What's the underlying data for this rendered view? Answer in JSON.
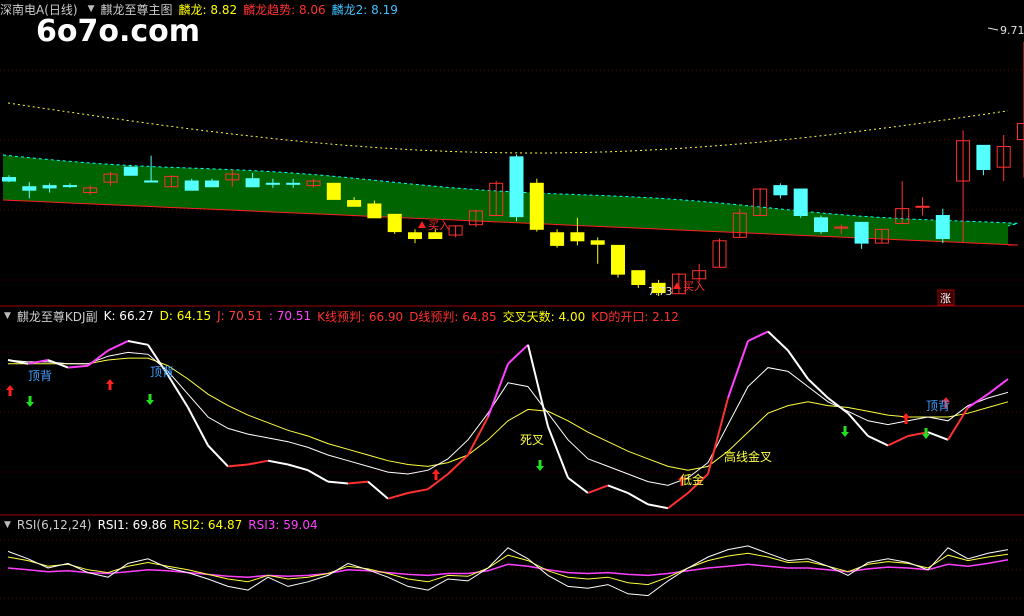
{
  "watermark": "6o7o.com",
  "main": {
    "title": "深南电A(日线)",
    "indicator": "麒龙至尊主图",
    "items": [
      {
        "label": "麟龙: 8.82",
        "color": "#ffff00"
      },
      {
        "label": "麟龙趋势: 8.06",
        "color": "#ff3030"
      },
      {
        "label": "麟龙2: 8.19",
        "color": "#40c0ff"
      }
    ],
    "high_label": "9.71",
    "low_label": "7.73",
    "buy_label": "买入",
    "zhang_badge": "涨"
  },
  "kdj": {
    "title": "麒龙至尊KDJ副",
    "items": [
      {
        "label": "K: 66.27",
        "color": "#ffffff"
      },
      {
        "label": "D: 64.15",
        "color": "#ffff00"
      },
      {
        "label": "J: 70.51",
        "color": "#ff4040"
      },
      {
        "label": ": 70.51",
        "color": "#ff40ff"
      },
      {
        "label": "K线预判: 66.90",
        "color": "#ff3030"
      },
      {
        "label": "D线预判: 64.85",
        "color": "#ff3030"
      },
      {
        "label": "交叉天数: 4.00",
        "color": "#ffff00"
      },
      {
        "label": "KD的开口: 2.12",
        "color": "#ff3030"
      }
    ],
    "annotations": [
      "顶背",
      "顶背",
      "死叉",
      "低金",
      "高线金叉",
      "顶背"
    ]
  },
  "rsi": {
    "title": "RSI(6,12,24)",
    "items": [
      {
        "label": "RSI1: 69.86",
        "color": "#ffffff"
      },
      {
        "label": "RSI2: 64.87",
        "color": "#ffff00"
      },
      {
        "label": "RSI3: 59.04",
        "color": "#ff40ff"
      }
    ]
  },
  "chart_data": {
    "type": "candlestick",
    "y_range": [
      7.5,
      9.9
    ],
    "candles": [
      {
        "o": 8.53,
        "h": 8.55,
        "l": 8.49,
        "c": 8.5,
        "up": false
      },
      {
        "o": 8.42,
        "h": 8.49,
        "l": 8.35,
        "c": 8.45,
        "up": false
      },
      {
        "o": 8.44,
        "h": 8.48,
        "l": 8.4,
        "c": 8.46,
        "up": false
      },
      {
        "o": 8.46,
        "h": 8.48,
        "l": 8.44,
        "c": 8.46,
        "up": false
      },
      {
        "o": 8.4,
        "h": 8.46,
        "l": 8.38,
        "c": 8.44,
        "up": true
      },
      {
        "o": 8.49,
        "h": 8.58,
        "l": 8.46,
        "c": 8.56,
        "up": true
      },
      {
        "o": 8.62,
        "h": 8.64,
        "l": 8.56,
        "c": 8.55,
        "up": false
      },
      {
        "o": 8.5,
        "h": 8.72,
        "l": 8.5,
        "c": 8.5,
        "up": false
      },
      {
        "o": 8.45,
        "h": 8.55,
        "l": 8.45,
        "c": 8.54,
        "up": true
      },
      {
        "o": 8.5,
        "h": 8.52,
        "l": 8.44,
        "c": 8.42,
        "up": false
      },
      {
        "o": 8.5,
        "h": 8.52,
        "l": 8.45,
        "c": 8.45,
        "up": false
      },
      {
        "o": 8.51,
        "h": 8.6,
        "l": 8.45,
        "c": 8.56,
        "up": true
      },
      {
        "o": 8.52,
        "h": 8.57,
        "l": 8.45,
        "c": 8.45,
        "up": false
      },
      {
        "o": 8.48,
        "h": 8.52,
        "l": 8.44,
        "c": 8.48,
        "up": false
      },
      {
        "o": 8.48,
        "h": 8.52,
        "l": 8.44,
        "c": 8.48,
        "up": false
      },
      {
        "o": 8.46,
        "h": 8.52,
        "l": 8.44,
        "c": 8.5,
        "up": true
      },
      {
        "o": 8.48,
        "h": 8.48,
        "l": 8.34,
        "c": 8.34,
        "up": false
      },
      {
        "o": 8.33,
        "h": 8.36,
        "l": 8.28,
        "c": 8.28,
        "up": false
      },
      {
        "o": 8.3,
        "h": 8.33,
        "l": 8.18,
        "c": 8.18,
        "up": false
      },
      {
        "o": 8.21,
        "h": 8.21,
        "l": 8.04,
        "c": 8.06,
        "up": false
      },
      {
        "o": 8.05,
        "h": 8.08,
        "l": 7.96,
        "c": 8.0,
        "up": false
      },
      {
        "o": 8.05,
        "h": 8.08,
        "l": 8.0,
        "c": 8.0,
        "up": false
      },
      {
        "o": 8.03,
        "h": 8.11,
        "l": 8.01,
        "c": 8.11,
        "up": true
      },
      {
        "o": 8.12,
        "h": 8.25,
        "l": 8.1,
        "c": 8.24,
        "up": true
      },
      {
        "o": 8.2,
        "h": 8.5,
        "l": 8.2,
        "c": 8.48,
        "up": true
      },
      {
        "o": 8.71,
        "h": 8.73,
        "l": 8.15,
        "c": 8.19,
        "up": false
      },
      {
        "o": 8.48,
        "h": 8.52,
        "l": 8.06,
        "c": 8.08,
        "up": false
      },
      {
        "o": 8.05,
        "h": 8.08,
        "l": 7.92,
        "c": 7.94,
        "up": false
      },
      {
        "o": 8.05,
        "h": 8.18,
        "l": 7.94,
        "c": 7.98,
        "up": false
      },
      {
        "o": 7.98,
        "h": 8.01,
        "l": 7.78,
        "c": 7.95,
        "up": false
      },
      {
        "o": 7.94,
        "h": 7.94,
        "l": 7.66,
        "c": 7.69,
        "up": false
      },
      {
        "o": 7.72,
        "h": 7.72,
        "l": 7.57,
        "c": 7.6,
        "up": false
      },
      {
        "o": 7.61,
        "h": 7.64,
        "l": 7.5,
        "c": 7.53,
        "up": false
      },
      {
        "o": 7.52,
        "h": 7.7,
        "l": 7.52,
        "c": 7.69,
        "up": true
      },
      {
        "o": 7.65,
        "h": 7.78,
        "l": 7.62,
        "c": 7.72,
        "up": true
      },
      {
        "o": 7.75,
        "h": 8.0,
        "l": 7.75,
        "c": 7.98,
        "up": true
      },
      {
        "o": 8.01,
        "h": 8.26,
        "l": 8.01,
        "c": 8.22,
        "up": true
      },
      {
        "o": 8.2,
        "h": 8.44,
        "l": 8.2,
        "c": 8.43,
        "up": true
      },
      {
        "o": 8.46,
        "h": 8.48,
        "l": 8.35,
        "c": 8.38,
        "up": false
      },
      {
        "o": 8.43,
        "h": 8.43,
        "l": 8.18,
        "c": 8.2,
        "up": false
      },
      {
        "o": 8.18,
        "h": 8.2,
        "l": 8.04,
        "c": 8.06,
        "up": false
      },
      {
        "o": 8.09,
        "h": 8.12,
        "l": 8.04,
        "c": 8.1,
        "up": true
      },
      {
        "o": 8.14,
        "h": 8.14,
        "l": 7.91,
        "c": 7.96,
        "up": false
      },
      {
        "o": 7.96,
        "h": 8.08,
        "l": 7.96,
        "c": 8.08,
        "up": true
      },
      {
        "o": 8.13,
        "h": 8.5,
        "l": 8.13,
        "c": 8.26,
        "up": true
      },
      {
        "o": 8.28,
        "h": 8.36,
        "l": 8.2,
        "c": 8.28,
        "up": true
      },
      {
        "o": 8.2,
        "h": 8.26,
        "l": 7.96,
        "c": 8.0,
        "up": false
      },
      {
        "o": 8.5,
        "h": 8.94,
        "l": 7.97,
        "c": 8.85,
        "up": true
      },
      {
        "o": 8.81,
        "h": 8.81,
        "l": 8.55,
        "c": 8.6,
        "up": false
      },
      {
        "o": 8.62,
        "h": 8.9,
        "l": 8.5,
        "c": 8.8,
        "up": true
      },
      {
        "o": 8.86,
        "h": 9.71,
        "l": 8.53,
        "c": 9.0,
        "up": true
      }
    ]
  }
}
